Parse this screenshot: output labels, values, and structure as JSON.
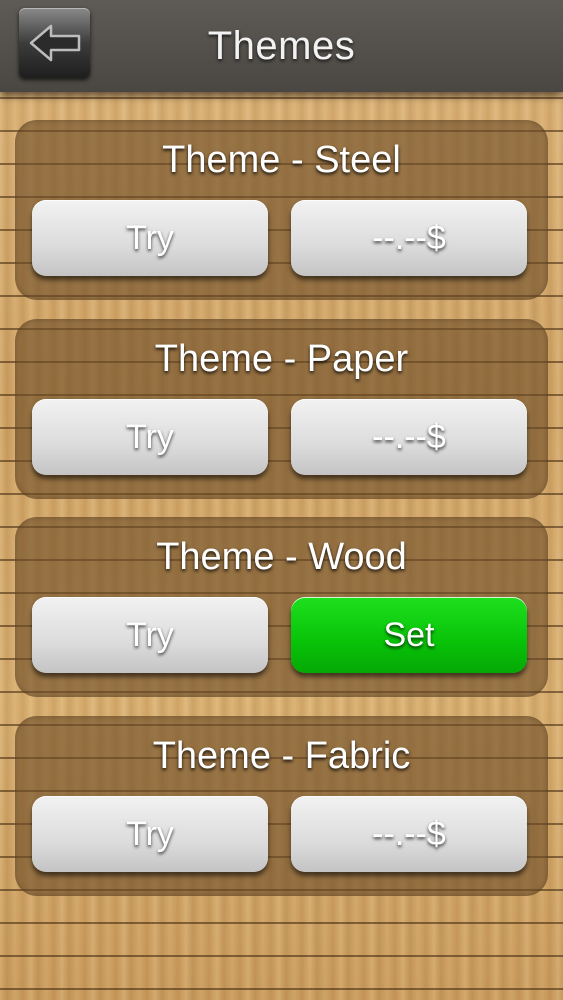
{
  "header": {
    "title": "Themes",
    "back_icon": "back-arrow-icon"
  },
  "themes": [
    {
      "name": "Theme - Steel",
      "try_label": "Try",
      "action_label": "--.--$",
      "action_state": "price"
    },
    {
      "name": "Theme - Paper",
      "try_label": "Try",
      "action_label": "--.--$",
      "action_state": "price"
    },
    {
      "name": "Theme - Wood",
      "try_label": "Try",
      "action_label": "Set",
      "action_state": "active"
    },
    {
      "name": "Theme - Fabric",
      "try_label": "Try",
      "action_label": "--.--$",
      "action_state": "price"
    }
  ],
  "colors": {
    "set_button": "#0ccc0c",
    "header_bar": "#54514d",
    "card_overlay": "#6e4e28"
  }
}
